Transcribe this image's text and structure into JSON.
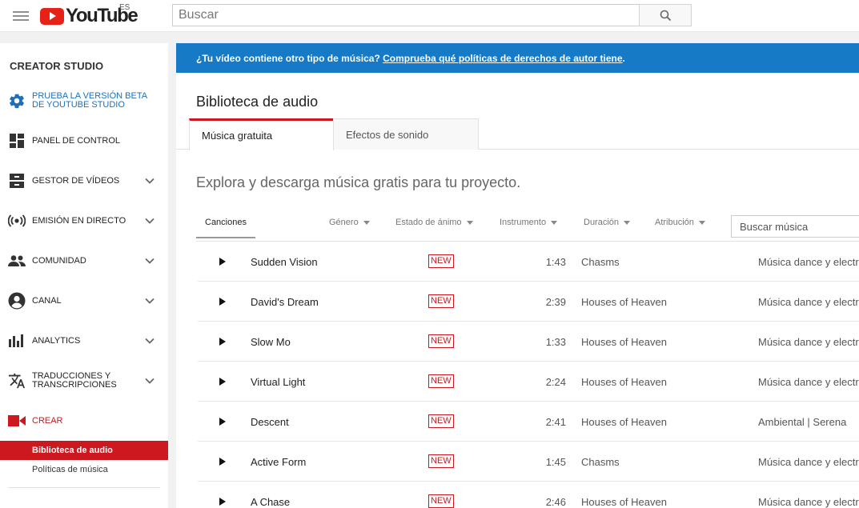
{
  "header": {
    "logo_text": "YouTube",
    "region": "ES",
    "search_placeholder": "Buscar"
  },
  "sidebar": {
    "title": "CREATOR STUDIO",
    "beta": {
      "line1": "PRUEBA LA VERSIÓN BETA",
      "line2": "DE YOUTUBE STUDIO"
    },
    "items": [
      {
        "label": "PANEL DE CONTROL"
      },
      {
        "label": "GESTOR DE VÍDEOS"
      },
      {
        "label": "EMISIÓN EN DIRECTO"
      },
      {
        "label": "COMUNIDAD"
      },
      {
        "label": "CANAL"
      },
      {
        "label": "ANALYTICS"
      },
      {
        "line1": "TRADUCCIONES Y",
        "line2": "TRANSCRIPCIONES"
      },
      {
        "label": "CREAR"
      }
    ],
    "sub_items": [
      {
        "label": "Biblioteca de audio"
      },
      {
        "label": "Políticas de música"
      }
    ]
  },
  "banner": {
    "text": "¿Tu vídeo contiene otro tipo de música? ",
    "link": "Comprueba qué políticas de derechos de autor tiene",
    "suffix": "."
  },
  "page": {
    "title": "Biblioteca de audio",
    "tabs": [
      "Música gratuita",
      "Efectos de sonido"
    ],
    "subtitle": "Explora y descarga música gratis para tu proyecto."
  },
  "filters": {
    "songs": "Canciones",
    "genre": "Género",
    "mood": "Estado de ánimo",
    "instrument": "Instrumento",
    "duration": "Duración",
    "attribution": "Atribución",
    "search_placeholder": "Buscar música"
  },
  "badge_label": "NEW",
  "tracks": [
    {
      "title": "Sudden Vision",
      "duration": "1:43",
      "artist": "Chasms",
      "genre": "Música dance y electrónica"
    },
    {
      "title": "David's Dream",
      "duration": "2:39",
      "artist": "Houses of Heaven",
      "genre": "Música dance y electrónica"
    },
    {
      "title": "Slow Mo",
      "duration": "1:33",
      "artist": "Houses of Heaven",
      "genre": "Música dance y electrónica"
    },
    {
      "title": "Virtual Light",
      "duration": "2:24",
      "artist": "Houses of Heaven",
      "genre": "Música dance y electrónica"
    },
    {
      "title": "Descent",
      "duration": "2:41",
      "artist": "Houses of Heaven",
      "genre": "Ambiental | Serena"
    },
    {
      "title": "Active Form",
      "duration": "1:45",
      "artist": "Chasms",
      "genre": "Música dance y electrónica"
    },
    {
      "title": "A Chase",
      "duration": "2:46",
      "artist": "Houses of Heaven",
      "genre": "Música dance y electrónica"
    }
  ]
}
